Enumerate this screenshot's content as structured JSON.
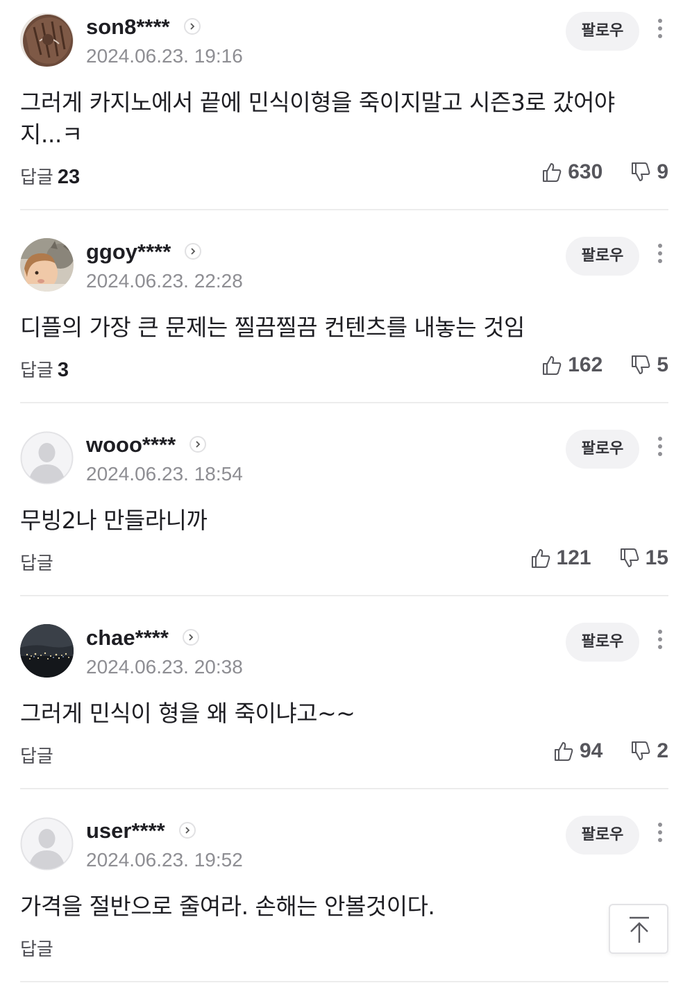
{
  "follow_label": "팔로우",
  "reply_label": "답글",
  "comments": [
    {
      "nickname": "son8****",
      "date": "2024.06.23. 19:16",
      "text": "그러게 카지노에서 끝에 민식이형을 죽이지말고 시즌3로 갔어야지...ㅋ",
      "replies": "23",
      "likes": "630",
      "dislikes": "9",
      "avatar": "baseball-glove"
    },
    {
      "nickname": "ggoy****",
      "date": "2024.06.23. 22:28",
      "text": "디플의 가장 큰 문제는 찔끔찔끔 컨텐츠를 내놓는 것임",
      "replies": "3",
      "likes": "162",
      "dislikes": "5",
      "avatar": "child-with-cat"
    },
    {
      "nickname": "wooo****",
      "date": "2024.06.23. 18:54",
      "text": "무빙2나 만들라니까",
      "replies": "",
      "likes": "121",
      "dislikes": "15",
      "avatar": "default-person"
    },
    {
      "nickname": "chae****",
      "date": "2024.06.23. 20:38",
      "text": "그러게 민식이 형을 왜 죽이냐고~~",
      "replies": "",
      "likes": "94",
      "dislikes": "2",
      "avatar": "night-city"
    },
    {
      "nickname": "user****",
      "date": "2024.06.23. 19:52",
      "text": "가격을 절반으로 줄여라. 손해는 안볼것이다.",
      "replies": "",
      "likes": "",
      "dislikes": "",
      "avatar": "default-person"
    }
  ],
  "colors": {
    "text": "#1e1e23",
    "meta": "#8e8e93",
    "divider": "#ececec",
    "follow_bg": "#f2f2f4"
  }
}
